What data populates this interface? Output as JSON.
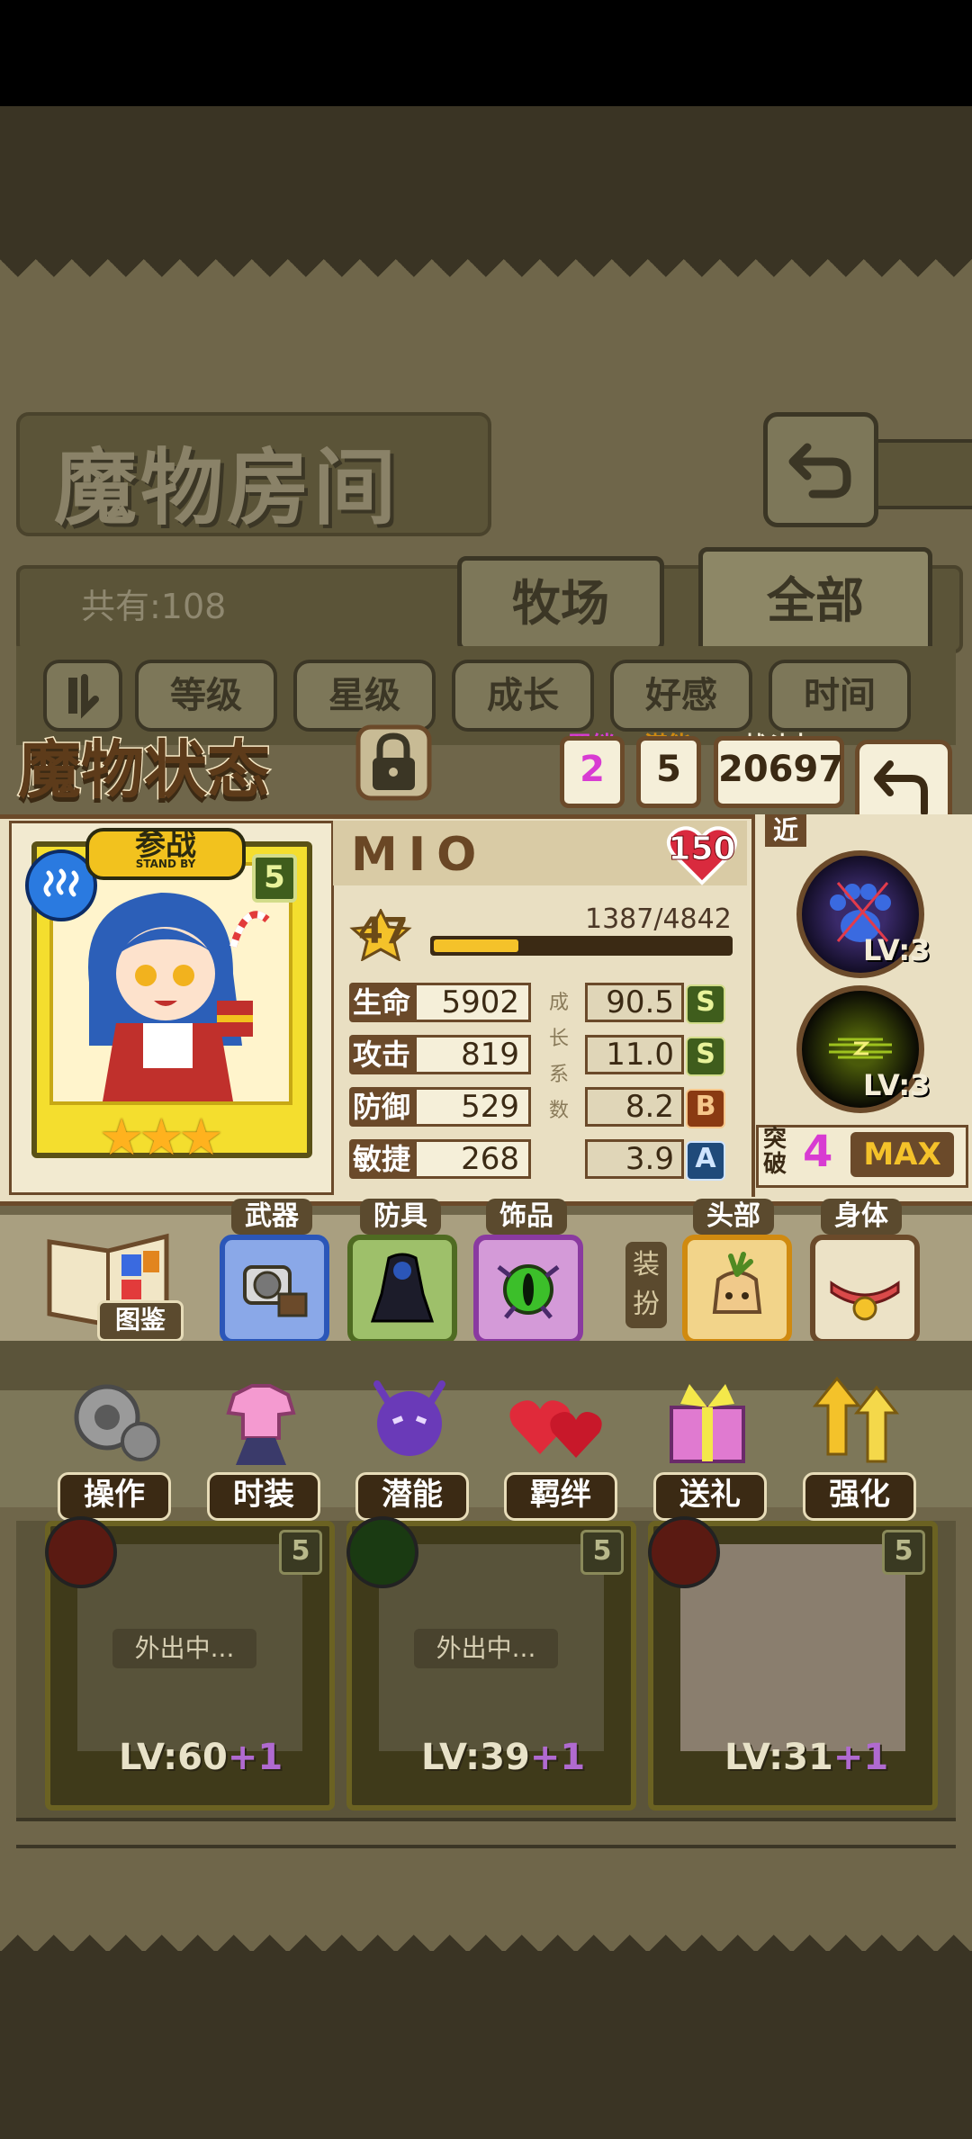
{
  "room": {
    "title": "魔物房间",
    "count_label": "共有:108",
    "tabs": [
      "牧场",
      "全部"
    ],
    "sort_buttons": [
      "等级",
      "星级",
      "成长",
      "好感",
      "时间"
    ]
  },
  "status": {
    "title": "魔物状态",
    "bond_label": "羁绊",
    "bond_value": "2",
    "potential_label": "潜能",
    "potential_value": "5",
    "power_label": "战斗力",
    "power_value": "20697",
    "affection": "150"
  },
  "monster": {
    "name": "MIO",
    "standby": "参战",
    "standby_en": "STAND BY",
    "star_badge": "5",
    "stars": "★★★",
    "level": "47",
    "exp": "1387/4842",
    "exp_fraction": 0.286,
    "growth_axis": [
      "成",
      "长",
      "系",
      "数"
    ],
    "stats": [
      {
        "label": "生命",
        "value": "5902",
        "growth": "90.5",
        "grade": "S"
      },
      {
        "label": "攻击",
        "value": "819",
        "growth": "11.0",
        "grade": "S"
      },
      {
        "label": "防御",
        "value": "529",
        "growth": "8.2",
        "grade": "B"
      },
      {
        "label": "敏捷",
        "value": "268",
        "growth": "3.9",
        "grade": "A"
      }
    ]
  },
  "skills": {
    "range": "近",
    "skill1_lv": "LV:3",
    "skill2_lv": "LV:3",
    "break_label": "突破",
    "break_value": "4",
    "max_label": "MAX"
  },
  "equipment": {
    "book_label": "图鉴",
    "weapon": "武器",
    "armor": "防具",
    "accessory": "饰品",
    "dress_label": "装扮",
    "head": "头部",
    "body": "身体"
  },
  "actions": [
    "操作",
    "时装",
    "潜能",
    "羁绊",
    "送礼",
    "强化"
  ],
  "roster": [
    {
      "away": "外出中...",
      "lv": "LV:60",
      "plus": "+1",
      "badge": "5"
    },
    {
      "away": "外出中...",
      "lv": "LV:39",
      "plus": "+1",
      "badge": "5"
    },
    {
      "lv": "LV:31",
      "plus": "+1",
      "badge": "5"
    }
  ],
  "colors": {
    "accent_gold": "#f4c22a",
    "panel_paper": "#e9dfc2",
    "frame_brown": "#6b4a2a",
    "break_magenta": "#d83bd2"
  }
}
